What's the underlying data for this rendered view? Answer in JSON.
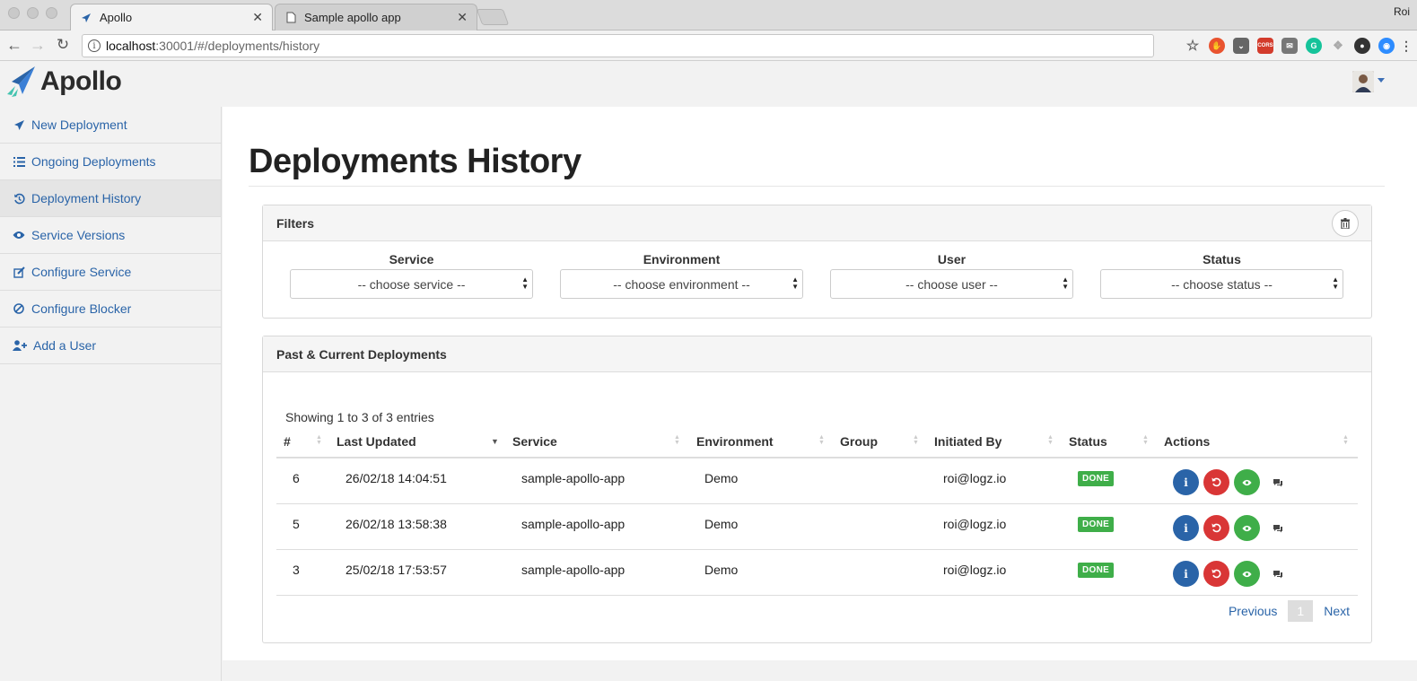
{
  "browser": {
    "profile_name": "Roi",
    "tabs": [
      {
        "title": "Apollo",
        "active": true
      },
      {
        "title": "Sample apollo app",
        "active": false
      }
    ],
    "url_host": "localhost",
    "url_path": ":30001/#/deployments/history",
    "extensions": [
      "star-icon",
      "adblock-icon",
      "pocket-icon",
      "cors-icon",
      "mail-icon",
      "grammarly-icon",
      "dropbox-icon",
      "github-icon",
      "zoom-icon",
      "menu-icon"
    ],
    "cors_label": "CORS"
  },
  "app": {
    "brand": "Apollo",
    "sidebar": {
      "items": [
        {
          "label": "New Deployment",
          "icon": "paper-plane-icon"
        },
        {
          "label": "Ongoing Deployments",
          "icon": "list-icon"
        },
        {
          "label": "Deployment History",
          "icon": "history-icon",
          "active": true
        },
        {
          "label": "Service Versions",
          "icon": "eye-icon"
        },
        {
          "label": "Configure Service",
          "icon": "edit-icon"
        },
        {
          "label": "Configure Blocker",
          "icon": "ban-icon"
        },
        {
          "label": "Add a User",
          "icon": "user-plus-icon"
        }
      ]
    },
    "page_title": "Deployments History",
    "filters": {
      "title": "Filters",
      "fields": [
        {
          "label": "Service",
          "value": "-- choose service --"
        },
        {
          "label": "Environment",
          "value": "-- choose environment --"
        },
        {
          "label": "User",
          "value": "-- choose user --"
        },
        {
          "label": "Status",
          "value": "-- choose status --"
        }
      ]
    },
    "deployments": {
      "title": "Past & Current Deployments",
      "entries_info": "Showing 1 to 3 of 3 entries",
      "columns": [
        "#",
        "Last Updated",
        "Service",
        "Environment",
        "Group",
        "Initiated By",
        "Status",
        "Actions"
      ],
      "rows": [
        {
          "id": "6",
          "updated": "26/02/18 14:04:51",
          "service": "sample-apollo-app",
          "environment": "Demo",
          "group": "",
          "initiated_by": "roi@logz.io",
          "status": "DONE"
        },
        {
          "id": "5",
          "updated": "26/02/18 13:58:38",
          "service": "sample-apollo-app",
          "environment": "Demo",
          "group": "",
          "initiated_by": "roi@logz.io",
          "status": "DONE"
        },
        {
          "id": "3",
          "updated": "25/02/18 17:53:57",
          "service": "sample-apollo-app",
          "environment": "Demo",
          "group": "",
          "initiated_by": "roi@logz.io",
          "status": "DONE"
        }
      ],
      "pagination": {
        "previous": "Previous",
        "current": "1",
        "next": "Next"
      }
    },
    "colors": {
      "link": "#2a64a8",
      "done": "#3fae49",
      "danger": "#d93636"
    }
  }
}
